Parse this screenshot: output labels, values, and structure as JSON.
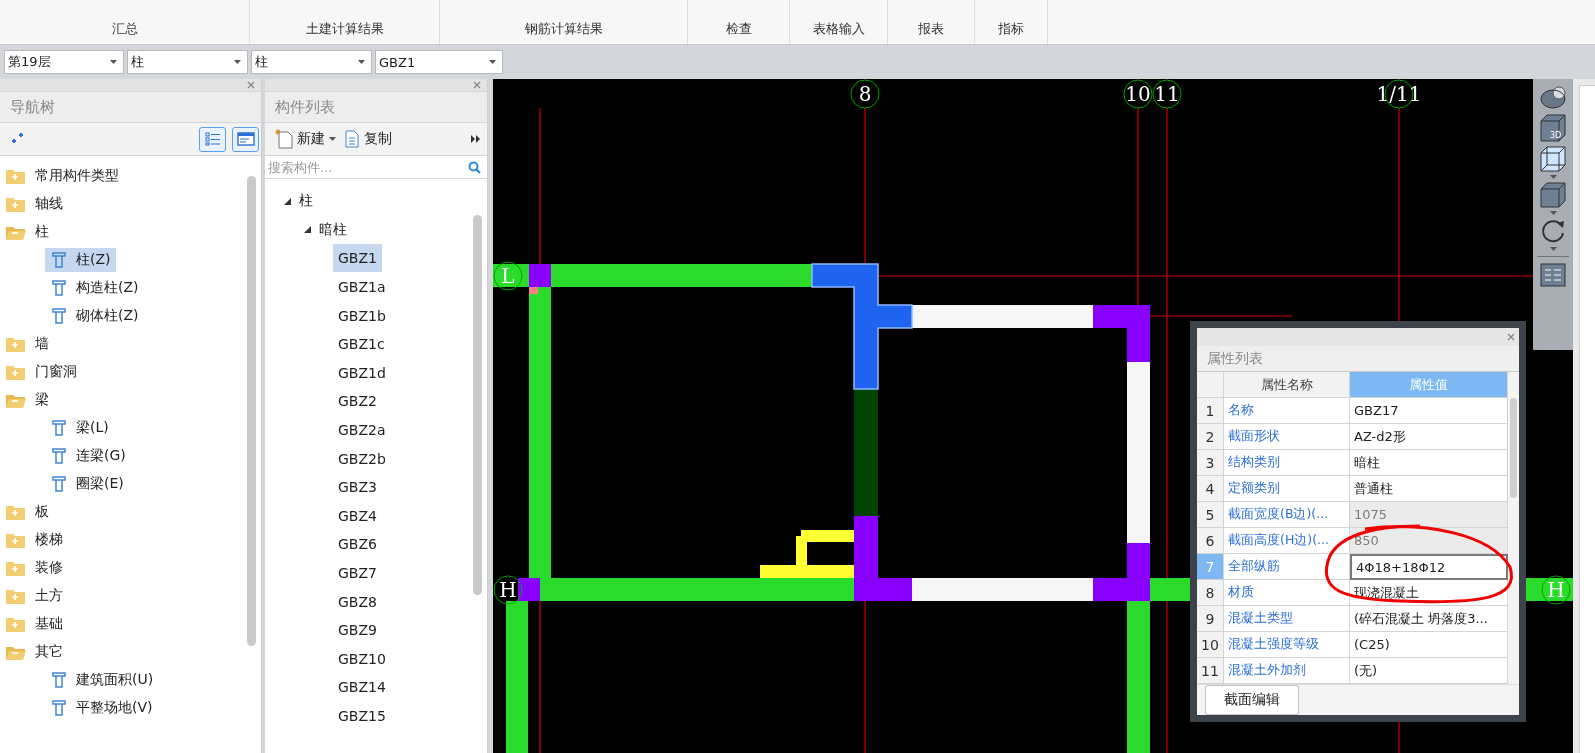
{
  "ribbon": {
    "tabs": [
      "汇总",
      "土建计算结果",
      "钢筋计算结果",
      "检查",
      "表格输入",
      "报表",
      "指标"
    ]
  },
  "selectors": [
    "第19层",
    "柱",
    "柱",
    "GBZ1"
  ],
  "nav_panel": {
    "title": "导航树",
    "tree": [
      {
        "label": "常用构件类型",
        "expanded": false
      },
      {
        "label": "轴线",
        "expanded": false
      },
      {
        "label": "柱",
        "expanded": true,
        "children": [
          {
            "label": "柱(Z)",
            "selected": true
          },
          {
            "label": "构造柱(Z)",
            "selected": false
          },
          {
            "label": "砌体柱(Z)",
            "selected": false
          }
        ]
      },
      {
        "label": "墙",
        "expanded": false
      },
      {
        "label": "门窗洞",
        "expanded": false
      },
      {
        "label": "梁",
        "expanded": true,
        "children": [
          {
            "label": "梁(L)",
            "selected": false
          },
          {
            "label": "连梁(G)",
            "selected": false
          },
          {
            "label": "圈梁(E)",
            "selected": false
          }
        ]
      },
      {
        "label": "板",
        "expanded": false
      },
      {
        "label": "楼梯",
        "expanded": false
      },
      {
        "label": "装修",
        "expanded": false
      },
      {
        "label": "土方",
        "expanded": false
      },
      {
        "label": "基础",
        "expanded": false
      },
      {
        "label": "其它",
        "expanded": true,
        "children": [
          {
            "label": "建筑面积(U)",
            "selected": false
          },
          {
            "label": "平整场地(V)",
            "selected": false
          }
        ]
      }
    ]
  },
  "component_panel": {
    "title": "构件列表",
    "new_button": "新建",
    "copy_button": "复制",
    "search": {
      "placeholder": "搜索构件..."
    },
    "tree": [
      {
        "label": "柱",
        "expanded": true,
        "children": [
          {
            "label": "暗柱",
            "expanded": true,
            "children": [
              {
                "label": "GBZ1",
                "selected": true
              },
              {
                "label": "GBZ1a",
                "selected": false
              },
              {
                "label": "GBZ1b",
                "selected": false
              },
              {
                "label": "GBZ1c",
                "selected": false
              },
              {
                "label": "GBZ1d",
                "selected": false
              },
              {
                "label": "GBZ2",
                "selected": false
              },
              {
                "label": "GBZ2a",
                "selected": false
              },
              {
                "label": "GBZ2b",
                "selected": false
              },
              {
                "label": "GBZ3",
                "selected": false
              },
              {
                "label": "GBZ4",
                "selected": false
              },
              {
                "label": "GBZ6",
                "selected": false
              },
              {
                "label": "GBZ7",
                "selected": false
              },
              {
                "label": "GBZ8",
                "selected": false
              },
              {
                "label": "GBZ9",
                "selected": false
              },
              {
                "label": "GBZ10",
                "selected": false
              },
              {
                "label": "GBZ14",
                "selected": false
              },
              {
                "label": "GBZ15",
                "selected": false
              }
            ]
          }
        ]
      }
    ]
  },
  "canvas": {
    "axis_labels": [
      "8",
      "10",
      "11",
      "1/11",
      "L",
      "H",
      "H"
    ]
  },
  "view_toolbar": {
    "cube_label": "3D"
  },
  "property_panel": {
    "title": "属性列表",
    "columns": [
      {
        "label": "属性名称",
        "selected": false
      },
      {
        "label": "属性值",
        "selected": true
      }
    ],
    "rows": [
      {
        "number": "1",
        "name": "名称",
        "value": "GBZ17",
        "disabled": false,
        "selected": false
      },
      {
        "number": "2",
        "name": "截面形状",
        "value": "AZ-d2形",
        "disabled": false,
        "selected": false
      },
      {
        "number": "3",
        "name": "结构类别",
        "value": "暗柱",
        "disabled": false,
        "selected": false
      },
      {
        "number": "4",
        "name": "定额类别",
        "value": "普通柱",
        "disabled": false,
        "selected": false
      },
      {
        "number": "5",
        "name": "截面宽度(B边)(...",
        "value": "1075",
        "disabled": true,
        "selected": false
      },
      {
        "number": "6",
        "name": "截面高度(H边)(...",
        "value": "850",
        "disabled": true,
        "selected": false
      },
      {
        "number": "7",
        "name": "全部纵筋",
        "value": "4Φ18+18Φ12",
        "disabled": false,
        "selected": true
      },
      {
        "number": "8",
        "name": "材质",
        "value": "现浇混凝土",
        "disabled": false,
        "selected": false
      },
      {
        "number": "9",
        "name": "混凝土类型",
        "value": "(碎石混凝土 坍落度3...",
        "disabled": false,
        "selected": false
      },
      {
        "number": "10",
        "name": "混凝土强度等级",
        "value": "(C25)",
        "disabled": false,
        "selected": false
      },
      {
        "number": "11",
        "name": "混凝土外加剂",
        "value": "(无)",
        "disabled": false,
        "selected": false
      }
    ],
    "edit_button": "截面编辑"
  }
}
